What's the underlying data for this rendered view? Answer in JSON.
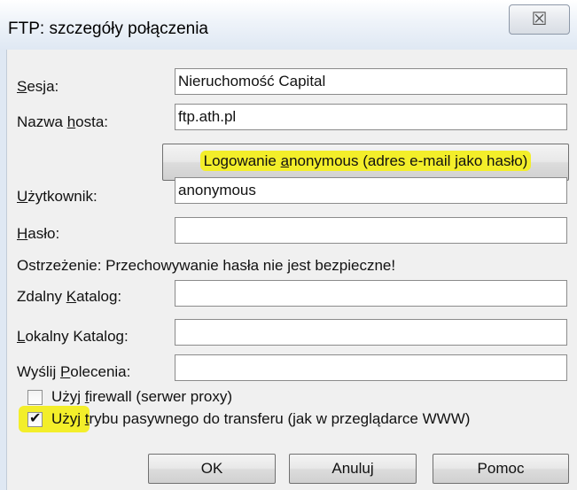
{
  "window": {
    "title": "FTP: szczegóły połączenia",
    "close_symbol": "☒"
  },
  "form": {
    "session": {
      "label": "Sesja:",
      "accel": "S",
      "rest": "esja:",
      "value": "Nieruchomość Capital"
    },
    "host": {
      "pre": "Nazwa ",
      "accel": "h",
      "rest": "osta:",
      "value": "ftp.ath.pl"
    },
    "anon_button": {
      "pre": "Logowanie ",
      "accel": "a",
      "rest": "nonymous (adres e-mail jako hasło)"
    },
    "user": {
      "accel": "U",
      "rest": "żytkownik:",
      "value": "anonymous"
    },
    "password": {
      "accel": "H",
      "rest": "asło:",
      "value": ""
    },
    "warning": "Ostrzeżenie: Przechowywanie hasła nie jest bezpieczne!",
    "remote_dir": {
      "pre": "Zdalny ",
      "accel": "K",
      "rest": "atalog:",
      "value": ""
    },
    "local_dir": {
      "accel": "L",
      "rest": "okalny Katalog:",
      "value": ""
    },
    "send_commands": {
      "pre": "Wyślij ",
      "accel": "P",
      "rest": "olecenia:",
      "value": ""
    },
    "firewall": {
      "pre": "Użyj ",
      "accel": "f",
      "rest": "irewall (serwer proxy)",
      "checked": false
    },
    "passive": {
      "pre": "Użyj ",
      "accel": "t",
      "rest": "rybu pasywnego do transferu (jak w przeglądarce WWW)",
      "checked": true,
      "check_mark": "✔"
    }
  },
  "buttons": {
    "ok": "OK",
    "cancel": "Anuluj",
    "help": "Pomoc"
  },
  "colors": {
    "highlight": "#f3ee2a",
    "dialog_bg": "#f0f0f0"
  }
}
